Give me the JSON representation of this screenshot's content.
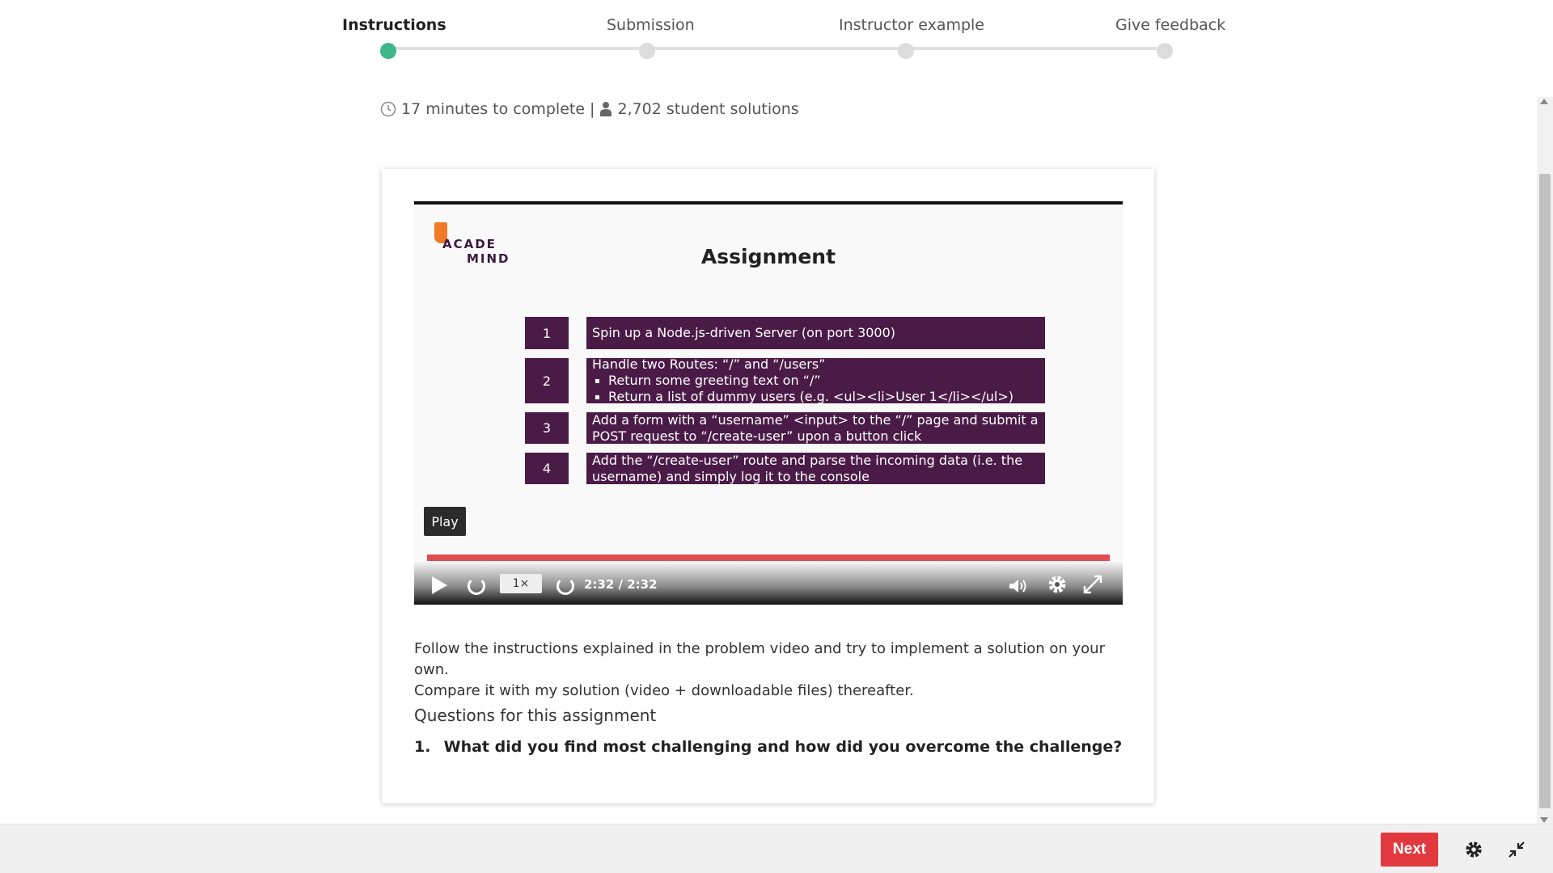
{
  "stepper": {
    "steps": [
      {
        "label": "Instructions",
        "active": true
      },
      {
        "label": "Submission",
        "active": false
      },
      {
        "label": "Instructor example",
        "active": false
      },
      {
        "label": "Give feedback",
        "active": false
      }
    ]
  },
  "meta": {
    "duration": "17 minutes to complete",
    "separator": "|",
    "solutions": "2,702 student solutions",
    "clock_icon": "clock-icon",
    "user_icon": "user-icon"
  },
  "video": {
    "logo_line1": "ACADE",
    "logo_line2": "MIND",
    "slide_title": "Assignment",
    "tasks": [
      {
        "num": "1",
        "lines": [
          "Spin up a Node.js-driven Server (on port 3000)"
        ],
        "subs": []
      },
      {
        "num": "2",
        "lines": [
          "Handle two Routes: “/” and “/users”"
        ],
        "subs": [
          "Return some greeting text on “/”",
          "Return a list of dummy users (e.g. <ul><li>User 1</li></ul>)"
        ]
      },
      {
        "num": "3",
        "lines": [
          "Add a form with a “username” <input> to the “/” page and submit a",
          "POST request to “/create-user” upon a button click"
        ],
        "subs": []
      },
      {
        "num": "4",
        "lines": [
          "Add the “/create-user” route and parse the incoming data (i.e. the",
          "username) and simply log it to the console"
        ],
        "subs": []
      }
    ],
    "play_tooltip": "Play",
    "speed": "1×",
    "time": "2:32 / 2:32",
    "progress": 1.0,
    "accent": "#e14c50"
  },
  "content": {
    "description_line1": "Follow the instructions explained in the problem video and try to implement a solution on your own.",
    "description_line2": "Compare it with my solution (video + downloadable files) thereafter.",
    "questions_heading": "Questions for this assignment",
    "questions": [
      {
        "num": "1.",
        "text": "What did you find most challenging and how did you overcome the challenge?"
      }
    ]
  },
  "footer": {
    "next_label": "Next",
    "next_color": "#e2393f",
    "settings_icon": "gear-icon",
    "collapse_icon": "collapse-icon"
  }
}
